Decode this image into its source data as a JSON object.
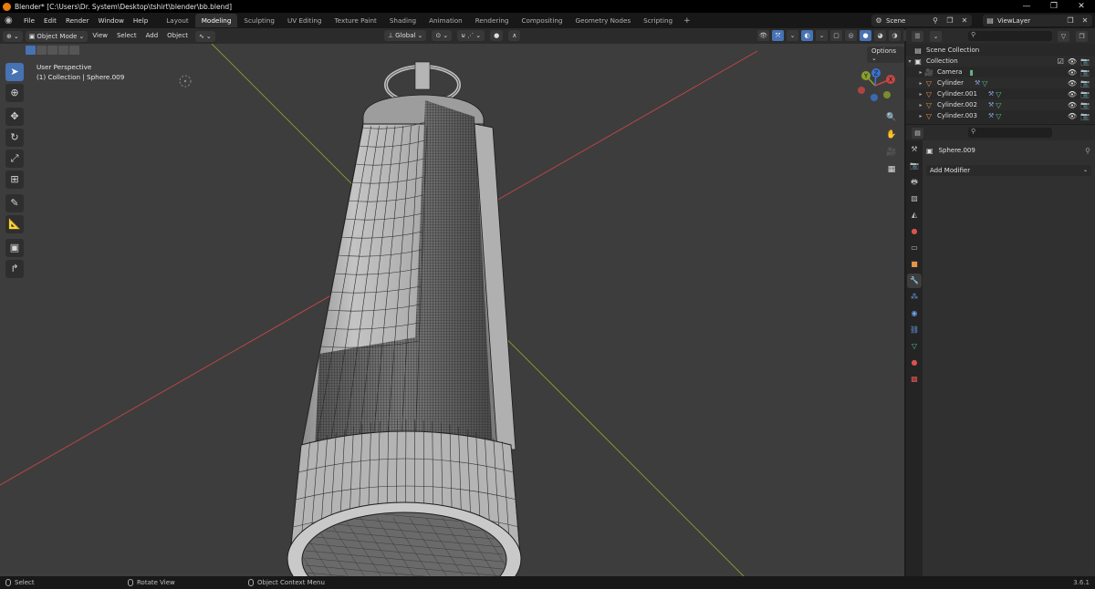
{
  "window": {
    "title": "Blender* [C:\\Users\\Dr. System\\Desktop\\tshirt\\blender\\bb.blend]",
    "minimize": "—",
    "maximize": "❐",
    "close": "✕"
  },
  "menu": [
    "File",
    "Edit",
    "Render",
    "Window",
    "Help"
  ],
  "workspaces": {
    "active": "Modeling",
    "tabs": [
      "Layout",
      "Modeling",
      "Sculpting",
      "UV Editing",
      "Texture Paint",
      "Shading",
      "Animation",
      "Rendering",
      "Compositing",
      "Geometry Nodes",
      "Scripting"
    ],
    "add": "+"
  },
  "scene": {
    "name": "Scene",
    "view_layer": "ViewLayer"
  },
  "viewport_header": {
    "mode": "Object Mode",
    "menus": [
      "View",
      "Select",
      "Add",
      "Object"
    ],
    "orientation": "Global"
  },
  "viewport": {
    "perspective": "User Perspective",
    "context": "(1) Collection | Sphere.009",
    "options_label": "Options ⌄",
    "gizmo": {
      "x": "X",
      "y": "Y",
      "z": "Z"
    },
    "colors": {
      "background": "#3d3d3d",
      "x_axis": "#c84646",
      "y_axis": "#8aa02a",
      "mesh": "#b8b8b8",
      "wire": "#1c1c1c"
    }
  },
  "outliner": {
    "root": "Scene Collection",
    "collection": "Collection",
    "items": [
      {
        "name": "Camera",
        "type": "camera"
      },
      {
        "name": "Cylinder",
        "type": "mesh"
      },
      {
        "name": "Cylinder.001",
        "type": "mesh"
      },
      {
        "name": "Cylinder.002",
        "type": "mesh"
      },
      {
        "name": "Cylinder.003",
        "type": "mesh"
      }
    ]
  },
  "properties": {
    "object_name": "Sphere.009",
    "add_modifier": "Add Modifier"
  },
  "statusbar": {
    "select": "Select",
    "rotate": "Rotate View",
    "context_menu": "Object Context Menu",
    "version": "3.6.1"
  }
}
